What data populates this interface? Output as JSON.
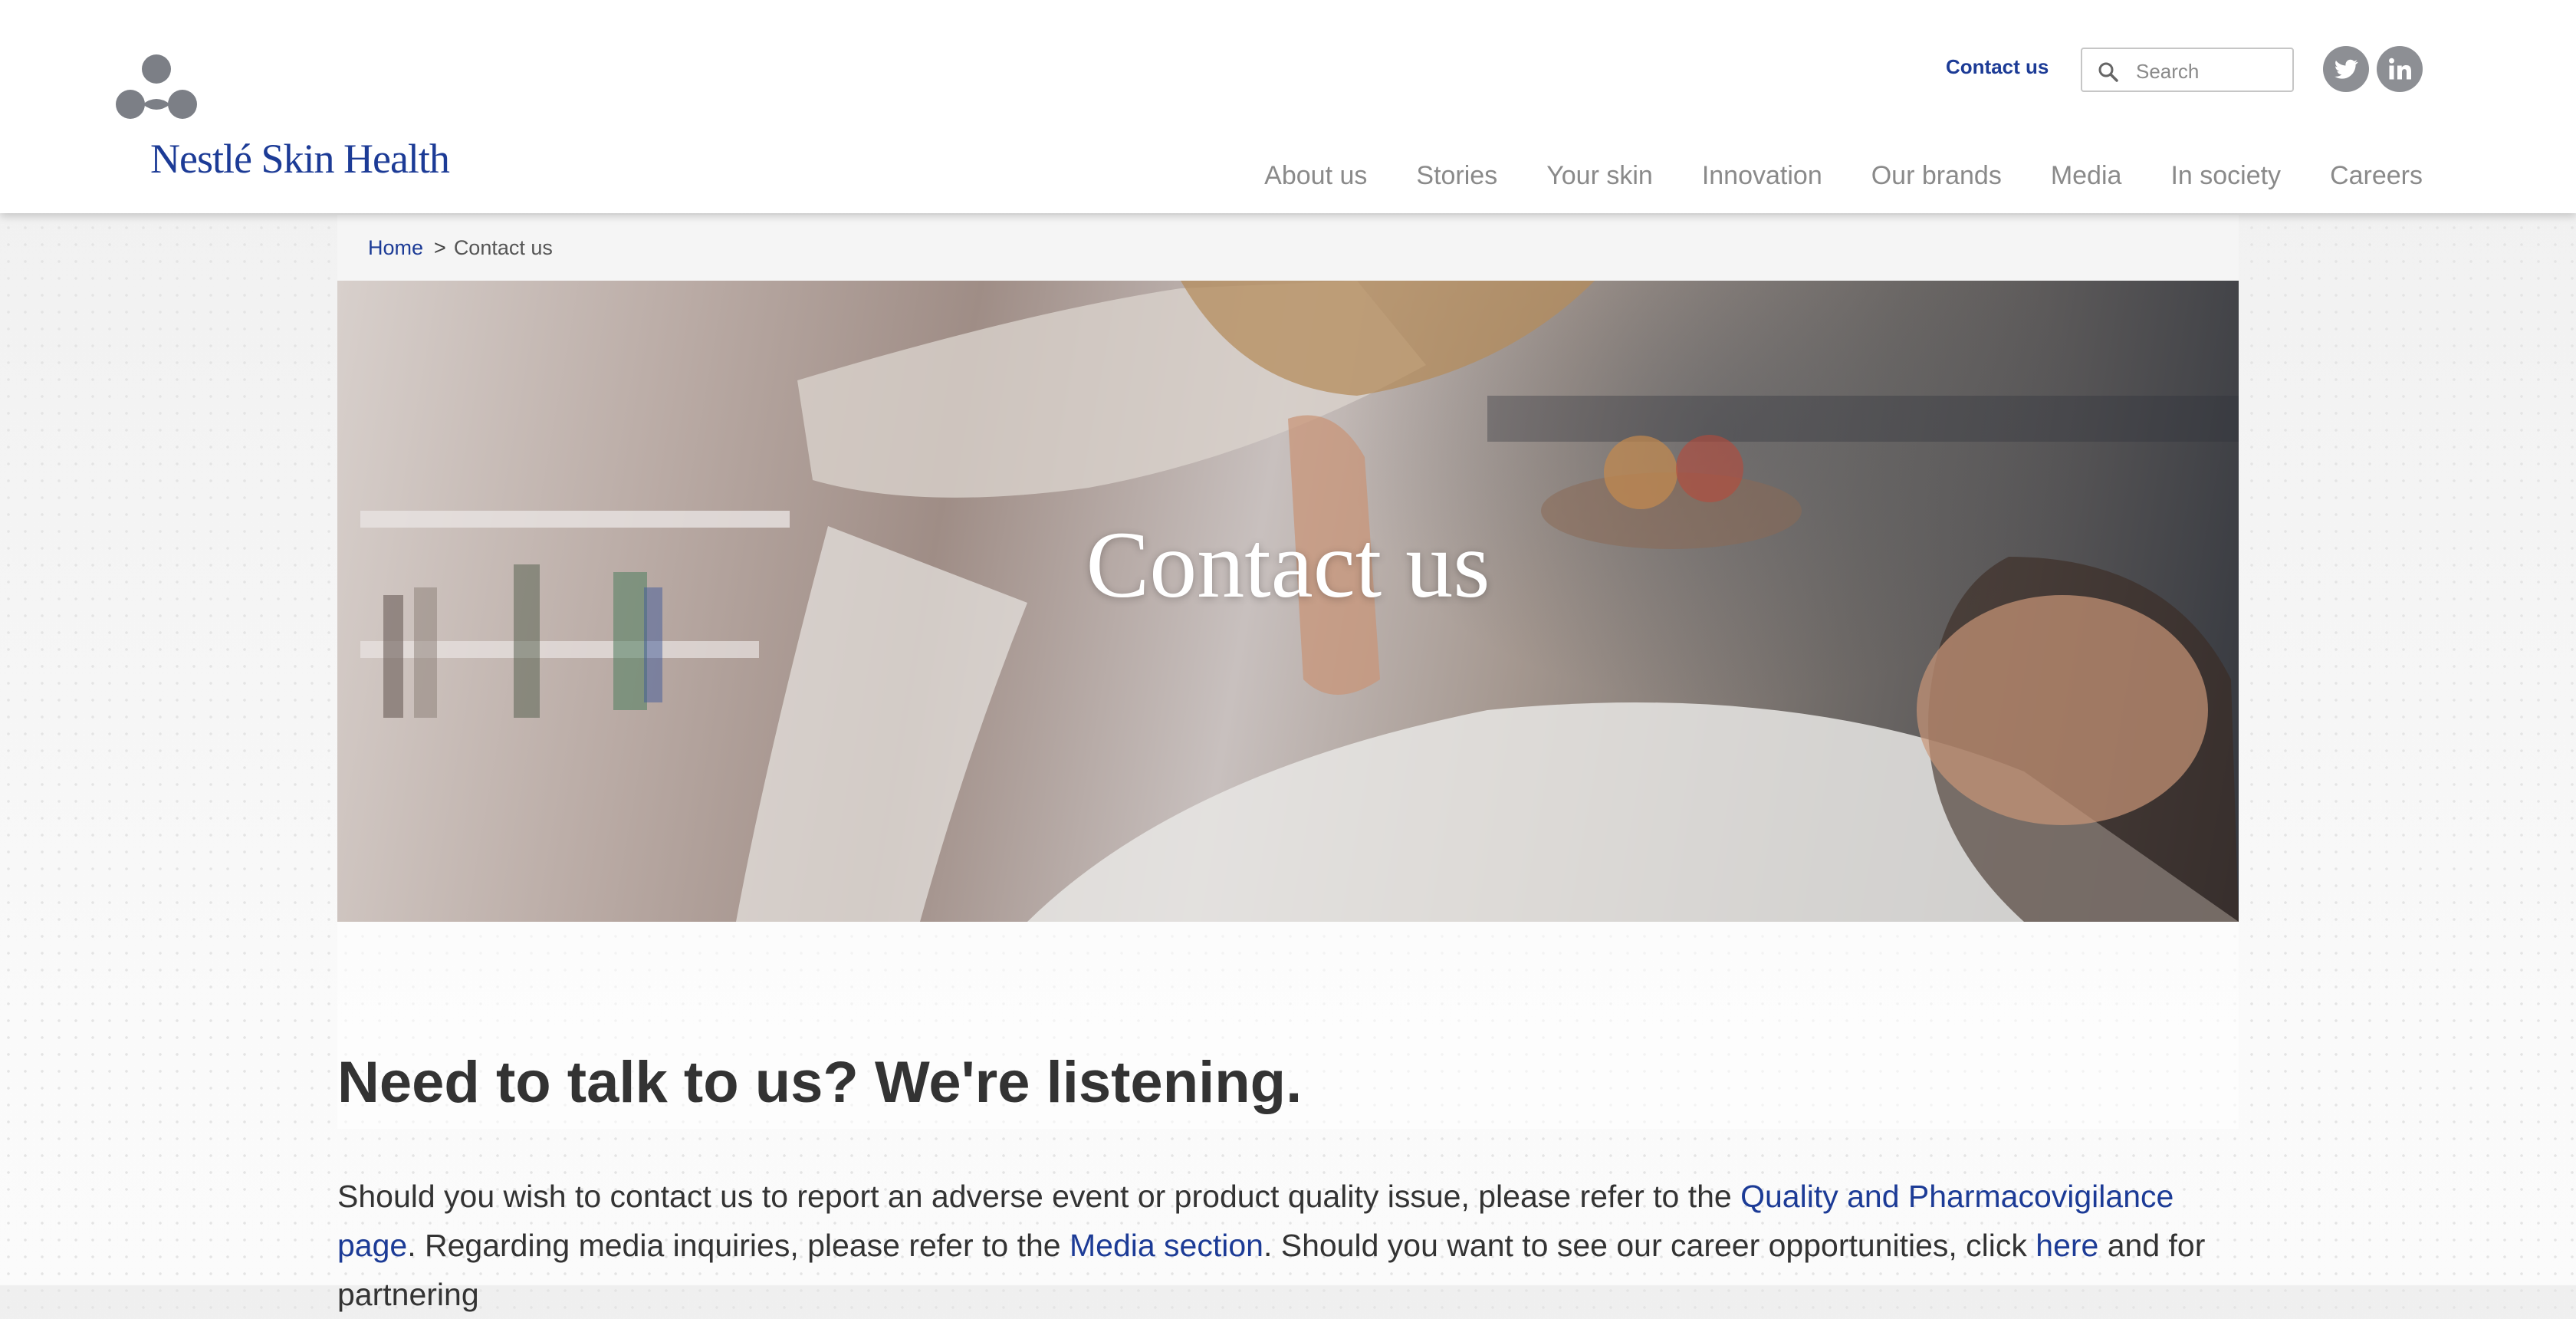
{
  "header": {
    "brand": "Nestlé Skin Health",
    "contact_link": "Contact us",
    "search": {
      "placeholder": "Search",
      "value": ""
    },
    "social": [
      "twitter-icon",
      "linkedin-icon"
    ],
    "nav": [
      "About us",
      "Stories",
      "Your skin",
      "Innovation",
      "Our brands",
      "Media",
      "In society",
      "Careers"
    ]
  },
  "breadcrumb": {
    "home": "Home",
    "separator": ">",
    "current": "Contact us"
  },
  "hero": {
    "title": "Contact us"
  },
  "content": {
    "heading": "Need to talk to us? We're listening.",
    "intro": {
      "t1": "Should you wish to contact us to report an adverse event or product quality issue, please refer to the ",
      "link1": "Quality and Pharmacovigilance page",
      "t2": ". Regarding media inquiries, please refer to the ",
      "link2": "Media section",
      "t3": ". Should you want to see our career opportunities, click ",
      "link3": "here",
      "t4": " and for partnering"
    }
  },
  "colors": {
    "brand_blue": "#1c3b96",
    "nav_gray": "#8a8a8a",
    "icon_gray": "#8d8f94"
  }
}
